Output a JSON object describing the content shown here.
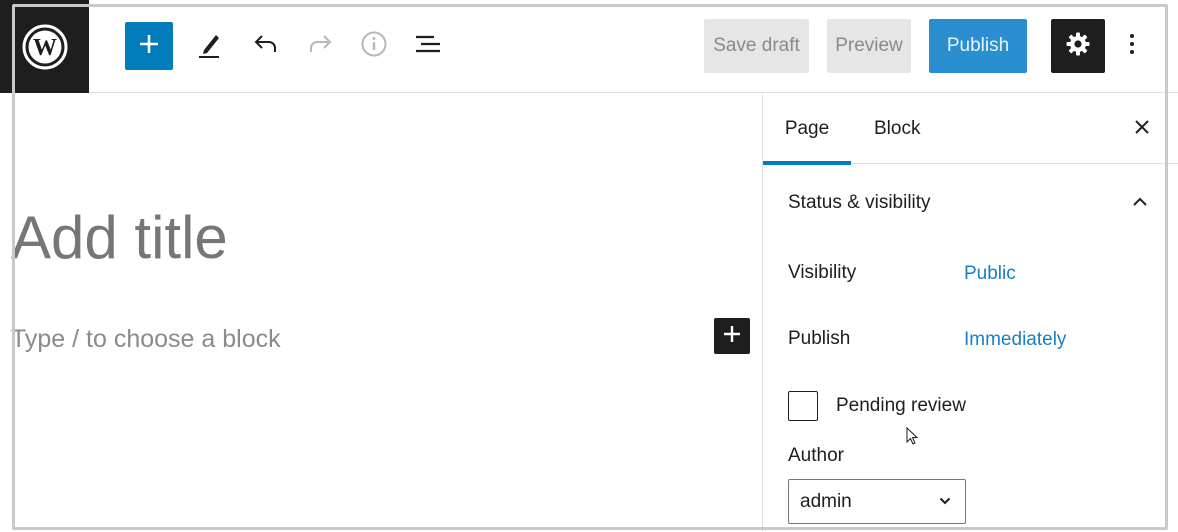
{
  "toolbar": {
    "save_draft_label": "Save draft",
    "preview_label": "Preview",
    "publish_label": "Publish",
    "icons": [
      "wordpress-logo-icon",
      "plus-icon",
      "pencil-icon",
      "undo-icon",
      "redo-icon",
      "info-icon",
      "list-view-icon",
      "gear-icon",
      "more-vertical-icon"
    ]
  },
  "editor": {
    "title_placeholder": "Add title",
    "block_placeholder": "Type / to choose a block"
  },
  "sidebar": {
    "tabs": [
      {
        "label": "Page",
        "active": true
      },
      {
        "label": "Block",
        "active": false
      }
    ],
    "panel_title": "Status & visibility",
    "visibility_label": "Visibility",
    "visibility_value": "Public",
    "publish_label": "Publish",
    "publish_value": "Immediately",
    "pending_review_label": "Pending review",
    "pending_review_checked": false,
    "author_label": "Author",
    "author_value": "admin"
  },
  "colors": {
    "accent": "#007cba",
    "link": "#1a7fc0",
    "dark": "#1e1e1e",
    "disabled_bg": "#e6e6e6"
  }
}
